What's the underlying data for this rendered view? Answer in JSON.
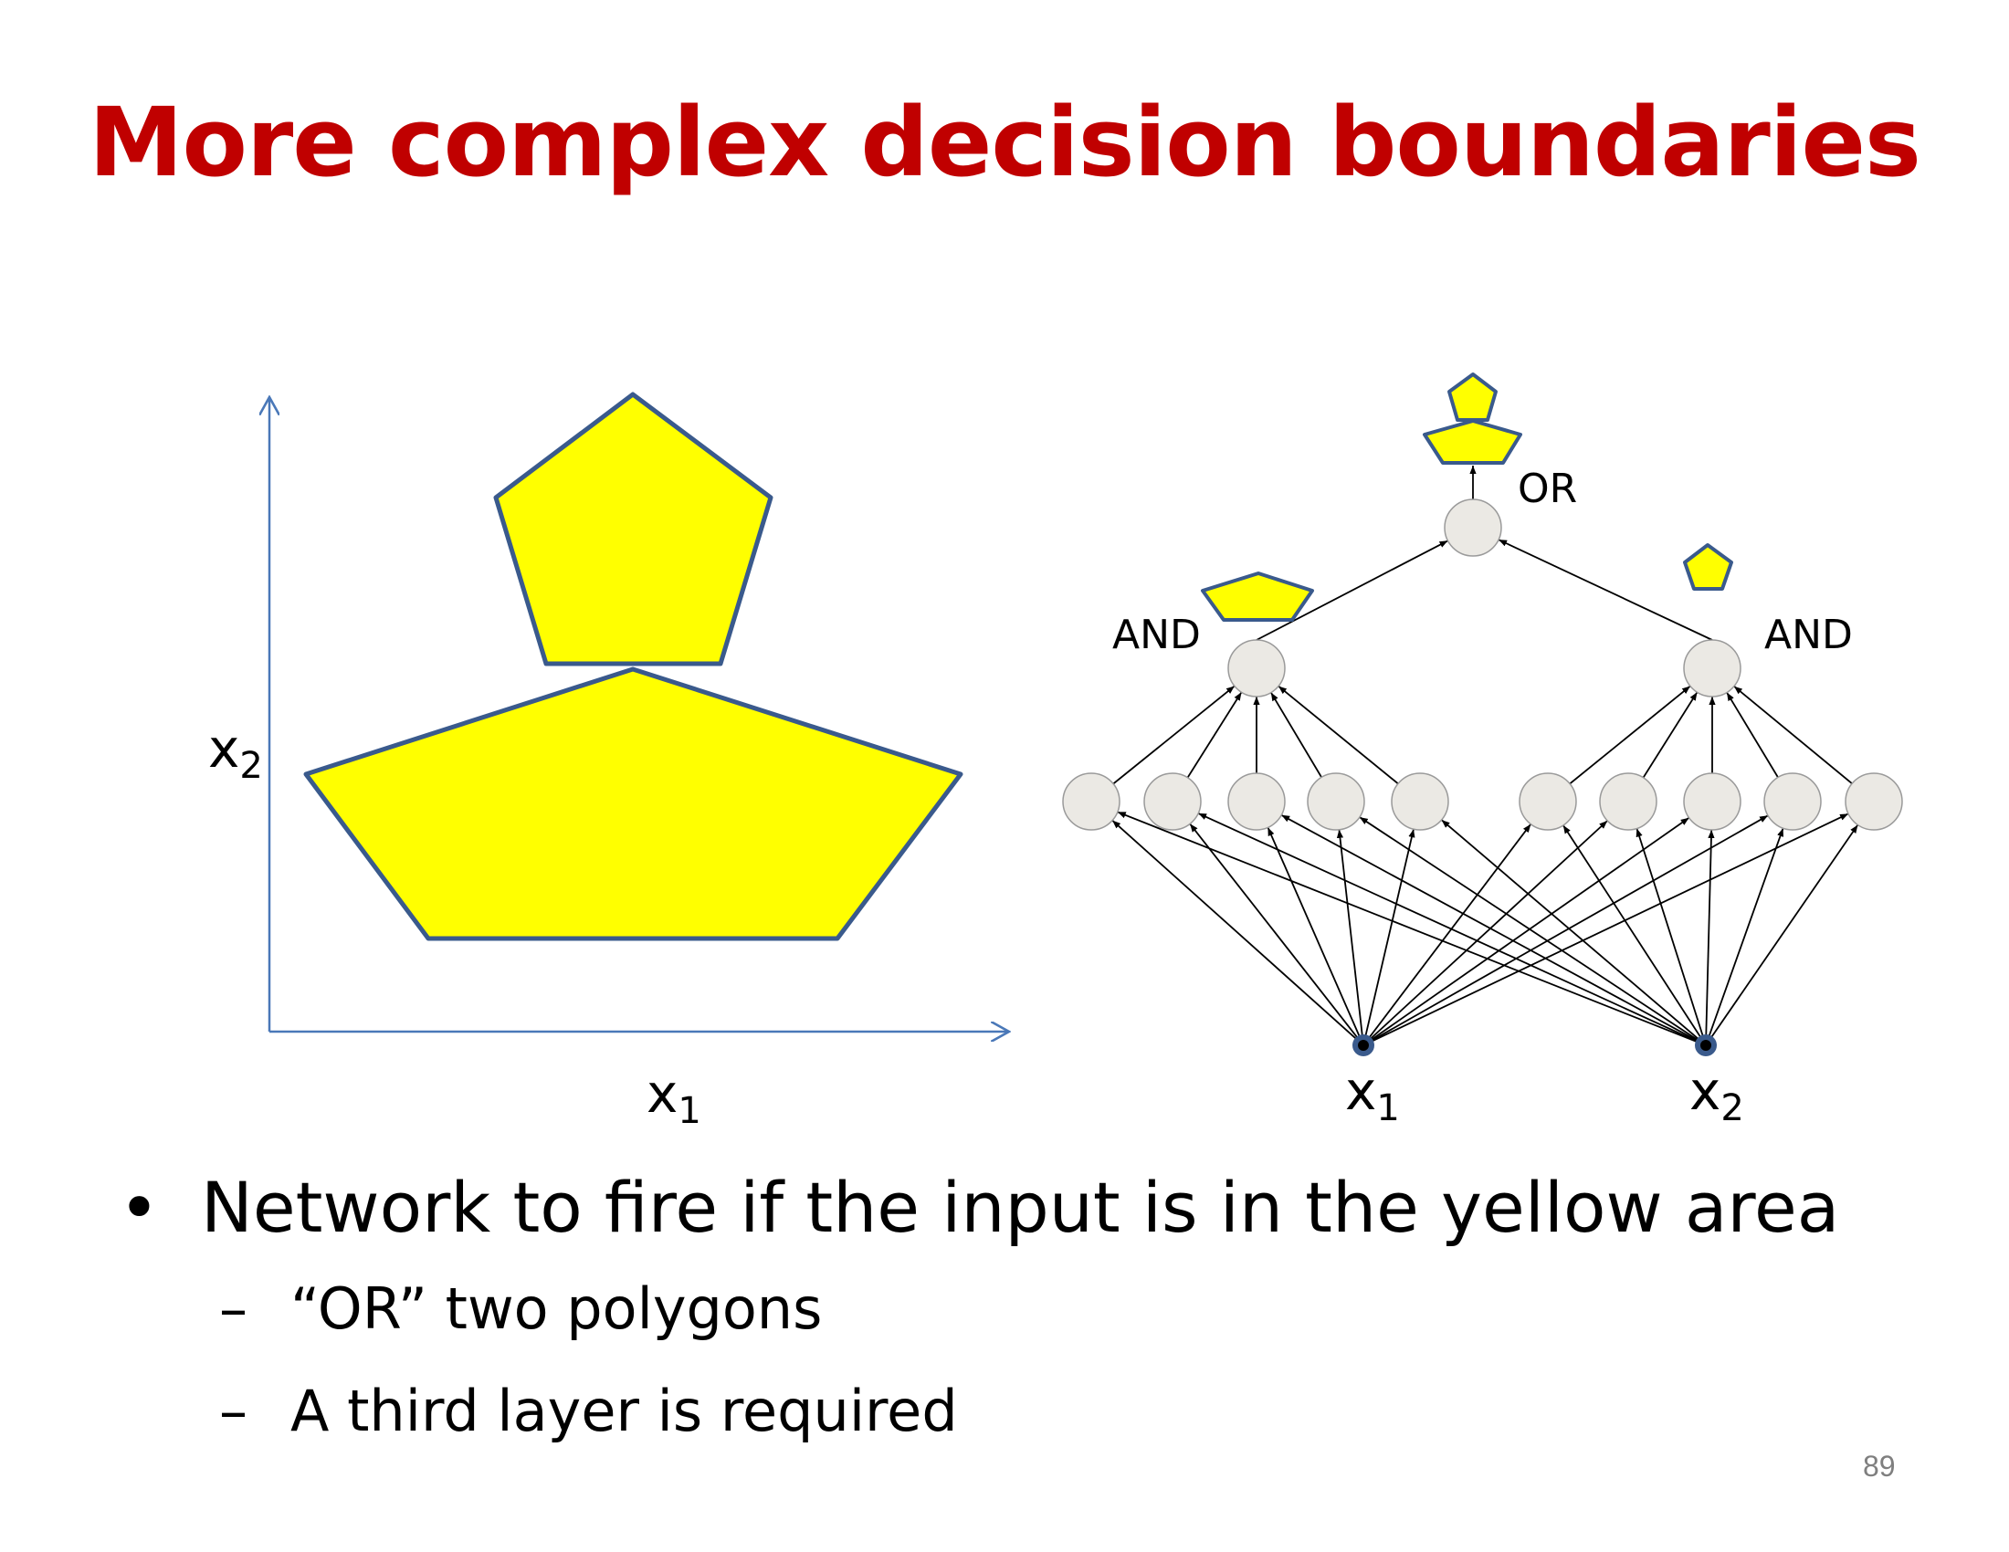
{
  "slide": {
    "title": "More complex decision boundaries",
    "page_number": "89"
  },
  "plot": {
    "x_label": "x",
    "x_label_sub": "1",
    "y_label": "x",
    "y_label_sub": "2",
    "fill_color": "#ffff00",
    "stroke_color": "#3a5a8c"
  },
  "network": {
    "or_label": "OR",
    "and_left_label": "AND",
    "and_right_label": "AND",
    "input1_label": "x",
    "input1_sub": "1",
    "input2_label": "x",
    "input2_sub": "2",
    "node_color": "#ebe9e4"
  },
  "bullets": {
    "main": "Network to fire if the input is in the yellow area",
    "marker": "•",
    "dash": "–",
    "sub": [
      "“OR” two polygons",
      "A third layer is required"
    ]
  }
}
